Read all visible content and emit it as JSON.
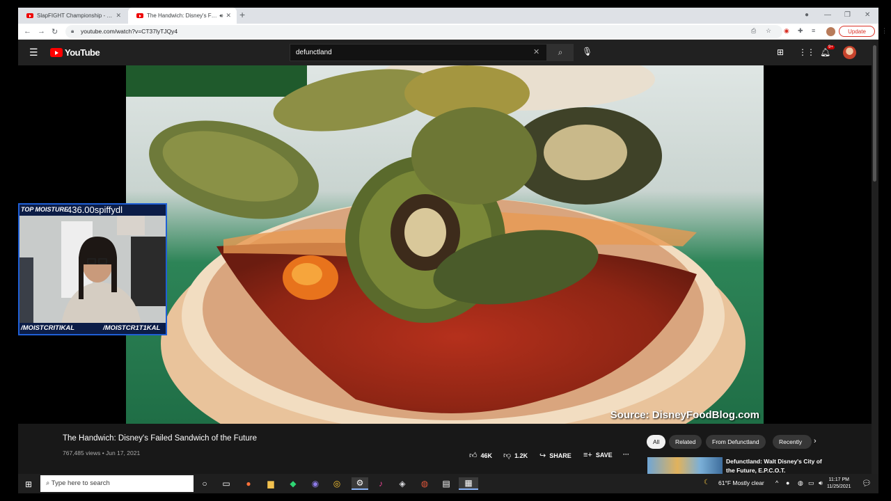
{
  "browser": {
    "tabs": [
      {
        "title": "SlapFIGHT Championship - YouTube"
      },
      {
        "title": "The Handwich: Disney's Failed Sandwich of the Future"
      }
    ],
    "url": "youtube.com/watch?v=CT37lyTJQy4",
    "update_label": "Update"
  },
  "youtube": {
    "logo_text": "YouTube",
    "search_value": "defunctland",
    "notification_badge": "9+"
  },
  "video": {
    "source_caption": "Source: DisneyFoodBlog.com",
    "title": "The Handwich: Disney's Failed Sandwich of the Future",
    "meta": "767,485 views • Jun 17, 2021",
    "likes": "46K",
    "dislikes": "1.2K",
    "share_label": "SHARE",
    "save_label": "SAVE",
    "more_label": "···"
  },
  "overlay": {
    "top_left": "TOP MOISTURE",
    "top_value": "436.00spiffydl",
    "bottom_left": "/MOISTCRITIKAL",
    "bottom_right": "/MOISTCR1T1KAL"
  },
  "chips": [
    "All",
    "Related",
    "From Defunctland",
    "Recently"
  ],
  "recommendation": {
    "title": "Defunctland: Walt Disney's City of the Future, E.P.C.O.T."
  },
  "taskbar": {
    "search_placeholder": "Type here to search",
    "weather": "61°F  Mostly clear",
    "time": "11:17 PM",
    "date": "11/25/2021"
  },
  "colors": {
    "yt_red": "#ff0000",
    "dark_bg": "#212121",
    "stream_frame": "#1f5fd6"
  }
}
